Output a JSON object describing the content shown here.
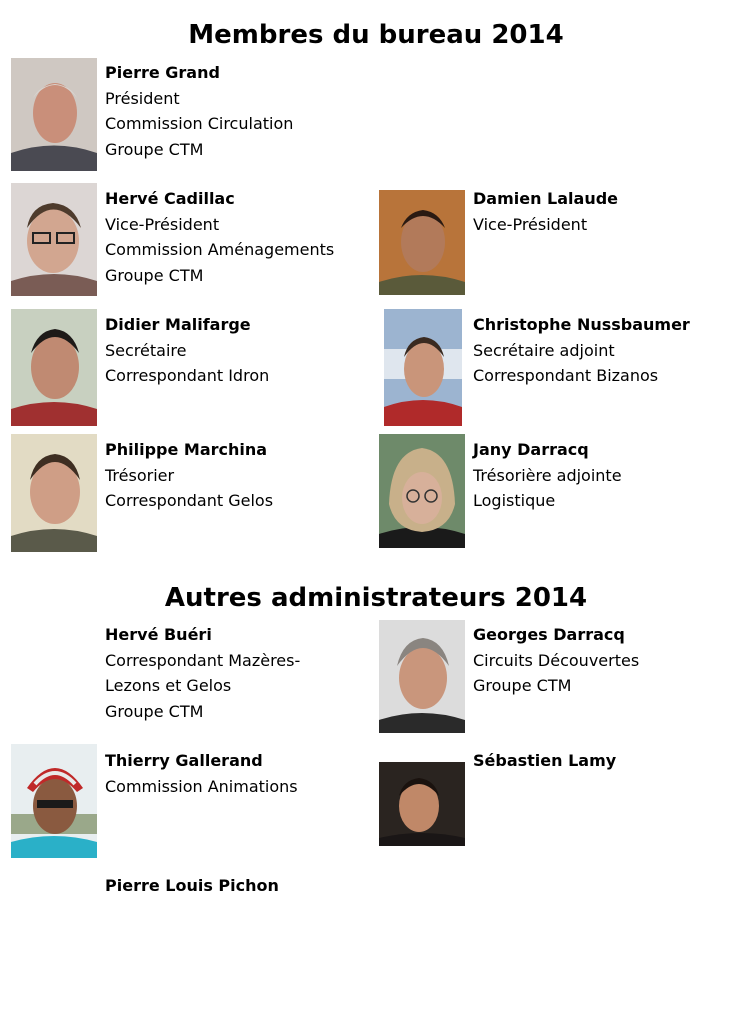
{
  "sections": {
    "bureau_title": "Membres du bureau 2014",
    "admins_title": "Autres administrateurs 2014"
  },
  "people": {
    "grand": {
      "name": "Pierre Grand",
      "lines": [
        "Président",
        "Commission Circulation",
        "Groupe CTM"
      ]
    },
    "cadillac": {
      "name": "Hervé Cadillac",
      "lines": [
        "Vice-Président",
        "Commission Aménagements",
        "Groupe CTM"
      ]
    },
    "lalaude": {
      "name": "Damien Lalaude",
      "lines": [
        "Vice-Président"
      ]
    },
    "malifarge": {
      "name": "Didier Malifarge",
      "lines": [
        "Secrétaire",
        "Correspondant Idron"
      ]
    },
    "nussbaumer": {
      "name": "Christophe Nussbaumer",
      "lines": [
        "Secrétaire adjoint",
        "Correspondant Bizanos"
      ]
    },
    "marchina": {
      "name": "Philippe Marchina",
      "lines": [
        "Trésorier",
        "Correspondant Gelos"
      ]
    },
    "darracq_j": {
      "name": "Jany Darracq",
      "lines": [
        "Trésorière adjointe",
        "Logistique"
      ]
    },
    "bueri": {
      "name": "Hervé Buéri",
      "lines": [
        "Correspondant Mazères-",
        "Lezons et Gelos",
        "Groupe CTM"
      ]
    },
    "darracq_g": {
      "name": "Georges Darracq",
      "lines": [
        "Circuits Découvertes",
        "Groupe CTM"
      ]
    },
    "gallerand": {
      "name": "Thierry Gallerand",
      "lines": [
        "Commission Animations"
      ]
    },
    "lamy": {
      "name": "Sébastien Lamy",
      "lines": []
    },
    "pichon": {
      "name": "Pierre Louis Pichon",
      "lines": []
    }
  }
}
